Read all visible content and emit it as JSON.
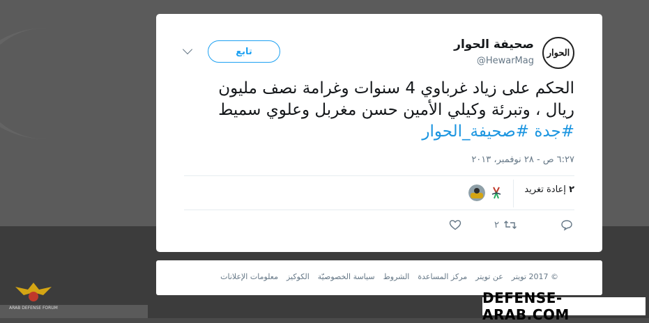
{
  "tweet": {
    "author_name": "صحيفة الحوار",
    "author_handle": "@HewarMag",
    "avatar_text": "الحوار",
    "follow_label": "تابع",
    "text_main": "الحكم على زياد غرباوي 4 سنوات وغرامة نصف مليون ريال ، وتبرئة وكيلي الأمين حسن مغربل وعلوي سميط",
    "hashtag_1": "#جدة",
    "hashtag_2": "#صحيفة_الحوار",
    "timestamp": "٦:٢٧ ص - ٢٨ نوفمبر، ٢٠١٣",
    "retweet_count": "٢",
    "retweet_label": "إعادة تغريد",
    "actions": {
      "reply_count": "",
      "retweet_count": "٢",
      "like_count": ""
    }
  },
  "footer": {
    "links": [
      "© 2017 تويتر",
      "عن تويتر",
      "مركز المساعدة",
      "الشروط",
      "سياسة الخصوصيّة",
      "الكوكيز",
      "معلومات الإعلانات"
    ]
  },
  "overlay": {
    "site_tag": "DEFENSE-ARAB.COM",
    "logo_text": "ARAB DEFENSE FORUM"
  },
  "colors": {
    "accent": "#1da1f2",
    "hashtag": "#1b95e0",
    "muted": "#657786"
  }
}
